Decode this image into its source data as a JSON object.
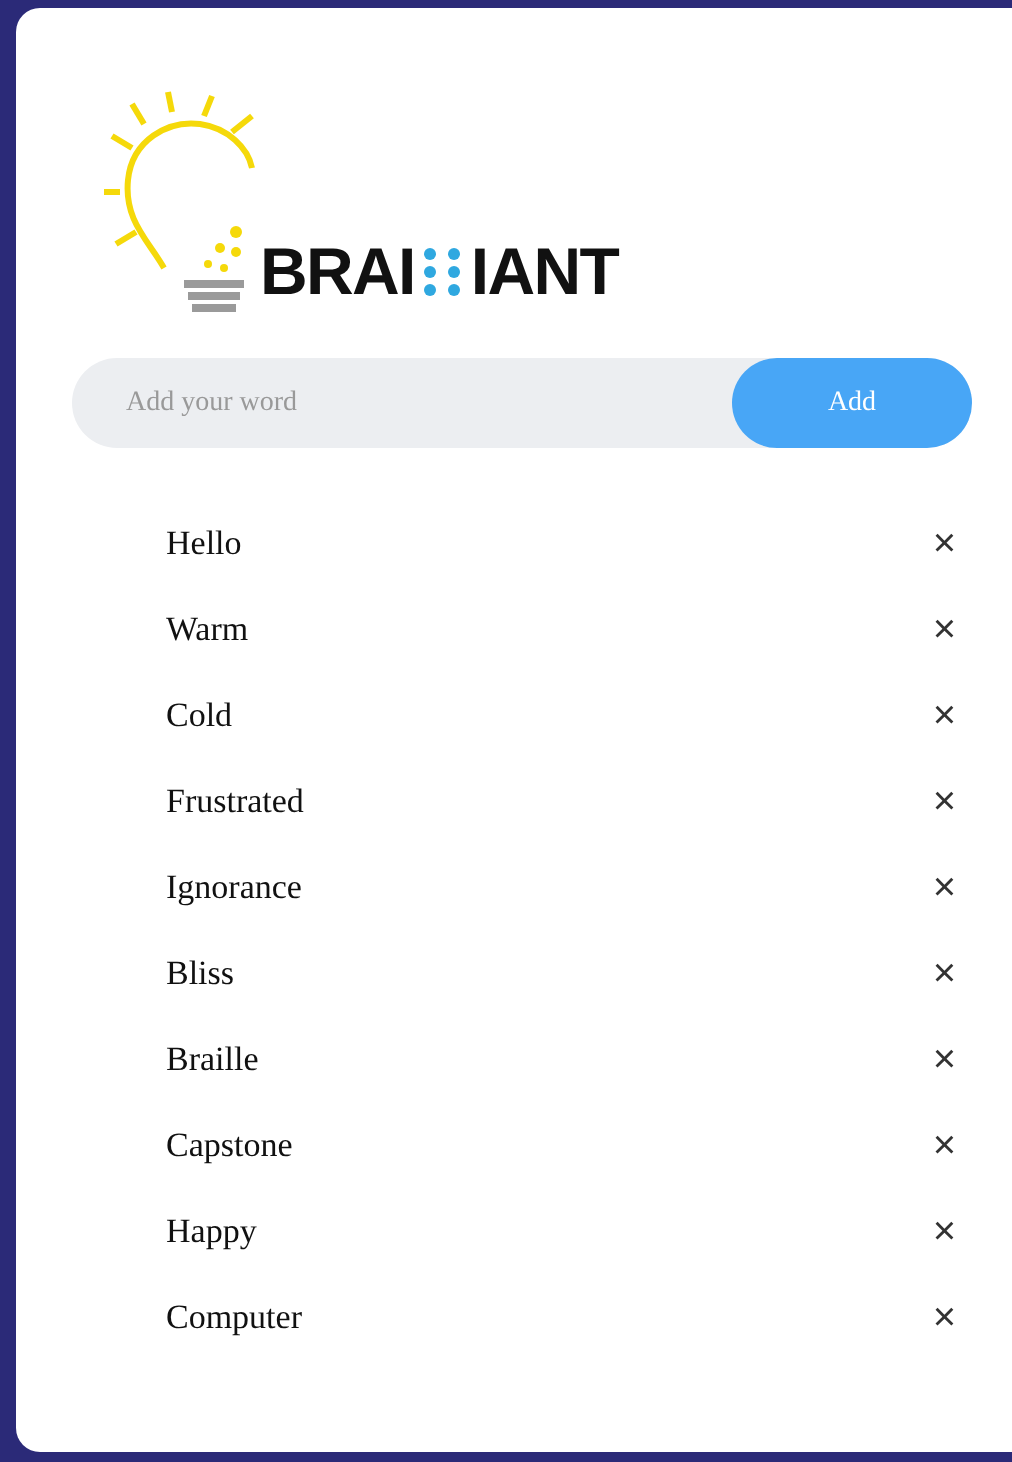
{
  "logo": {
    "left": "BRAI",
    "right": "IANT"
  },
  "entry": {
    "placeholder": "Add your word",
    "button": "Add"
  },
  "words": [
    {
      "text": "Hello",
      "remove": "×"
    },
    {
      "text": "Warm",
      "remove": "×"
    },
    {
      "text": "Cold",
      "remove": "×"
    },
    {
      "text": "Frustrated",
      "remove": "×"
    },
    {
      "text": "Ignorance",
      "remove": "×"
    },
    {
      "text": "Bliss",
      "remove": "×"
    },
    {
      "text": "Braille",
      "remove": "×"
    },
    {
      "text": "Capstone",
      "remove": "×"
    },
    {
      "text": "Happy",
      "remove": "×"
    },
    {
      "text": "Computer",
      "remove": "×"
    }
  ]
}
